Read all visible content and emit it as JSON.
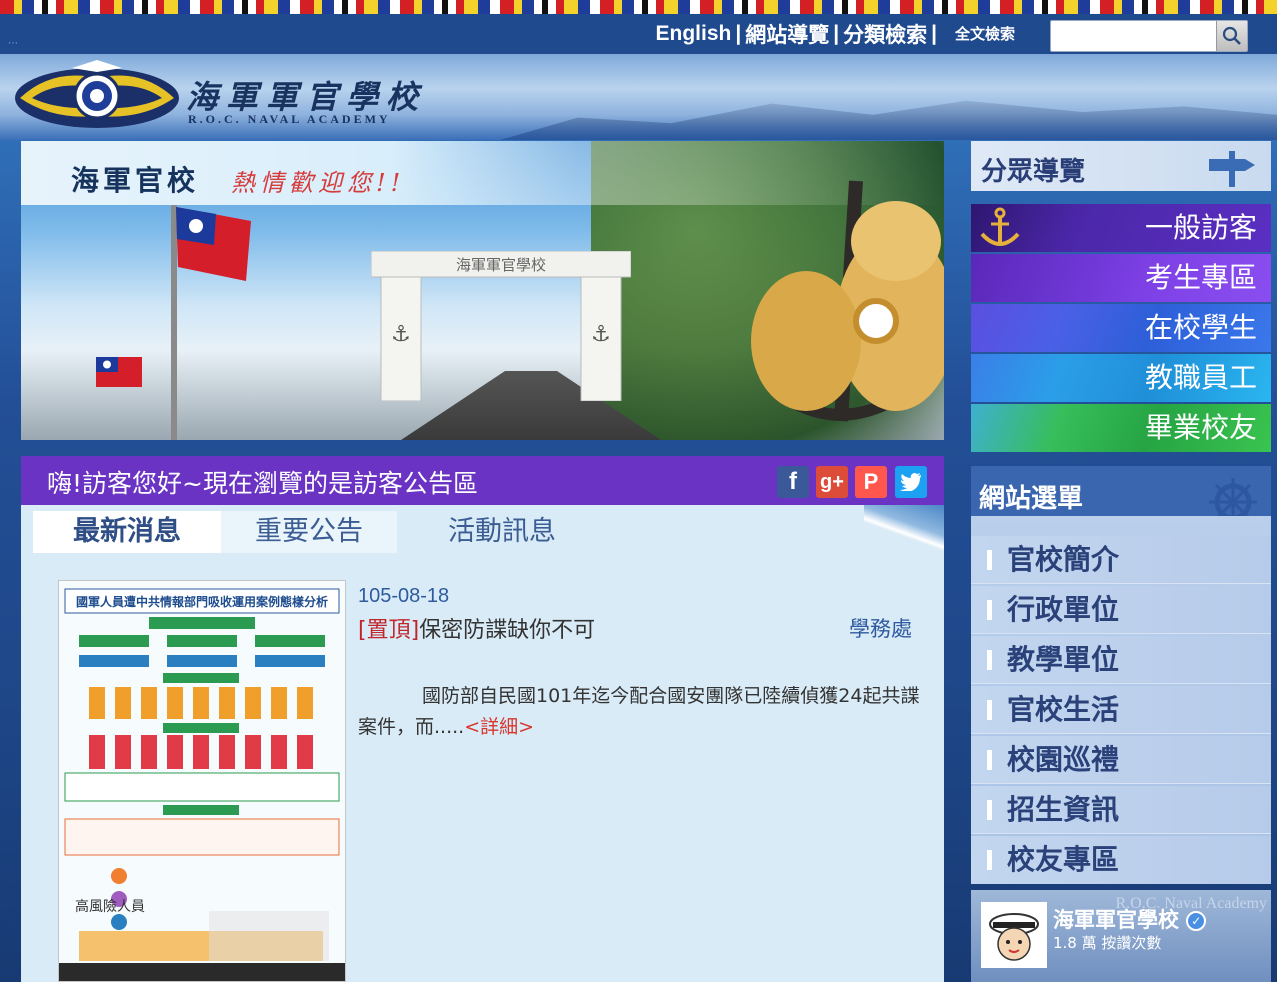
{
  "topnav": {
    "links": [
      "English",
      "網站導覽",
      "分類檢索"
    ],
    "fulltext_label": "全文檢索",
    "search_placeholder": ""
  },
  "header": {
    "school_name": "海軍軍官學校",
    "school_name_en": "R.O.C. NAVAL ACADEMY"
  },
  "banner": {
    "title": "海軍官校",
    "welcome": "熱情歡迎您!!",
    "gate_text": "海軍軍官學校"
  },
  "audience_nav": {
    "title": "分眾導覽",
    "items": [
      {
        "label": "一般訪客",
        "color": "#4b27a8"
      },
      {
        "label": "考生專區",
        "color": "#7b3be0"
      },
      {
        "label": "在校學生",
        "color": "#3d66e0"
      },
      {
        "label": "教職員工",
        "color": "#23a8e8"
      },
      {
        "label": "畢業校友",
        "color": "#3bbf4e"
      }
    ]
  },
  "announcement": {
    "greeting": "嗨!訪客您好~現在瀏覽的是訪客公告區",
    "social_icons": [
      "facebook-icon",
      "google-plus-icon",
      "plurk-icon",
      "twitter-icon"
    ],
    "tabs": [
      "最新消息",
      "重要公告",
      "活動訊息"
    ],
    "news": {
      "date": "105-08-18",
      "pin": "[置頂]",
      "title": "保密防諜缺你不可",
      "department": "學務處",
      "body": "國防部自民國101年迄今配合國安團隊已陸續偵獲24起共諜案件，而.....",
      "more": "<詳細>",
      "poster_title": "國軍人員遭中共情報部門吸收運用案例態樣分析"
    }
  },
  "site_menu": {
    "title": "網站選單",
    "items": [
      "官校簡介",
      "行政單位",
      "教學單位",
      "官校生活",
      "校園巡禮",
      "招生資訊",
      "校友專區"
    ]
  },
  "facebook": {
    "page_name": "海軍軍官學校",
    "likes": "1.8 萬 按讚次數",
    "cover_text": "R.O.C. Naval Academy"
  }
}
